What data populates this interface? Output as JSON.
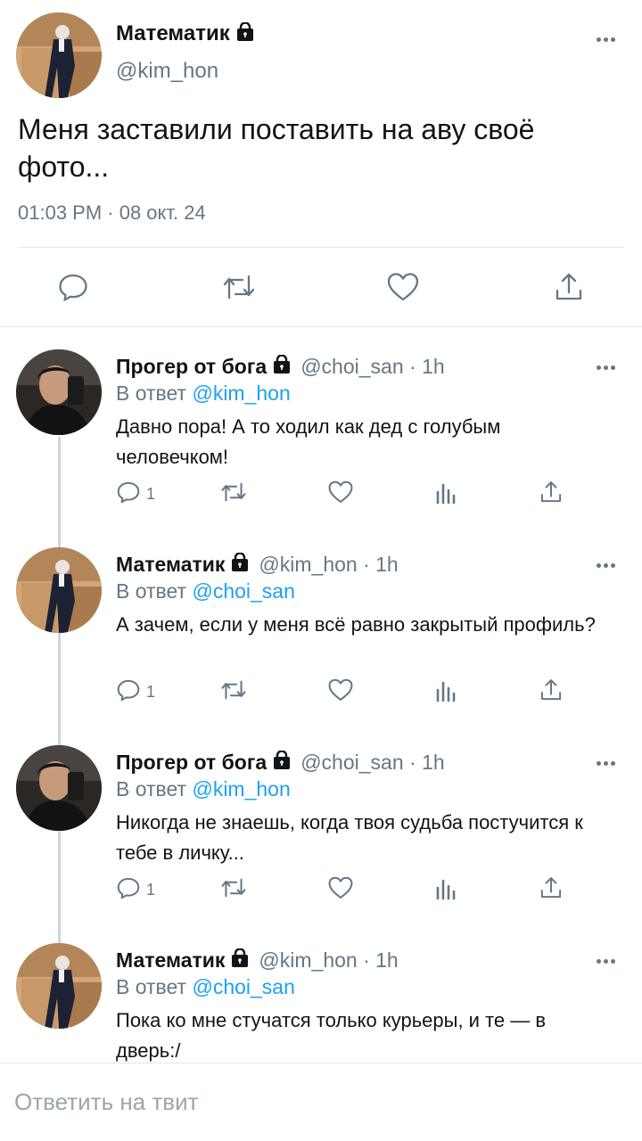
{
  "main_tweet": {
    "author_name": "Математик",
    "author_handle": "@kim_hon",
    "text": "Меня заставили поставить на аву своё фото...",
    "timestamp": "01:03 PM · 08 окт. 24"
  },
  "replies": [
    {
      "author_name": "Прогер от бога",
      "meta": "@choi_san · 1h",
      "reply_label": "В ответ",
      "reply_to": "@kim_hon",
      "text": "Давно пора! А то ходил как дед с голубым человечком!",
      "reply_count": "1"
    },
    {
      "author_name": "Математик",
      "meta": "@kim_hon · 1h",
      "reply_label": "В ответ",
      "reply_to": "@choi_san",
      "text": "А зачем, если у меня всё равно закрытый профиль?",
      "reply_count": "1"
    },
    {
      "author_name": "Прогер от бога",
      "meta": "@choi_san · 1h",
      "reply_label": "В ответ",
      "reply_to": "@kim_hon",
      "text": "Никогда не знаешь, когда твоя судьба постучится к тебе в личку...",
      "reply_count": "1"
    },
    {
      "author_name": "Математик",
      "meta": "@kim_hon · 1h",
      "reply_label": "В ответ",
      "reply_to": "@choi_san",
      "text": "Пока ко мне стучатся только курьеры, и те — в дверь:/",
      "reply_count": ""
    }
  ],
  "reply_box": {
    "placeholder": "Ответить на твит"
  },
  "colors": {
    "text": "#0f1419",
    "secondary": "#657786",
    "link": "#1da1f2",
    "divider": "#e1e8ed"
  },
  "icons": [
    "lock-icon",
    "more-icon",
    "reply-icon",
    "retweet-icon",
    "like-icon",
    "views-icon",
    "share-icon"
  ]
}
